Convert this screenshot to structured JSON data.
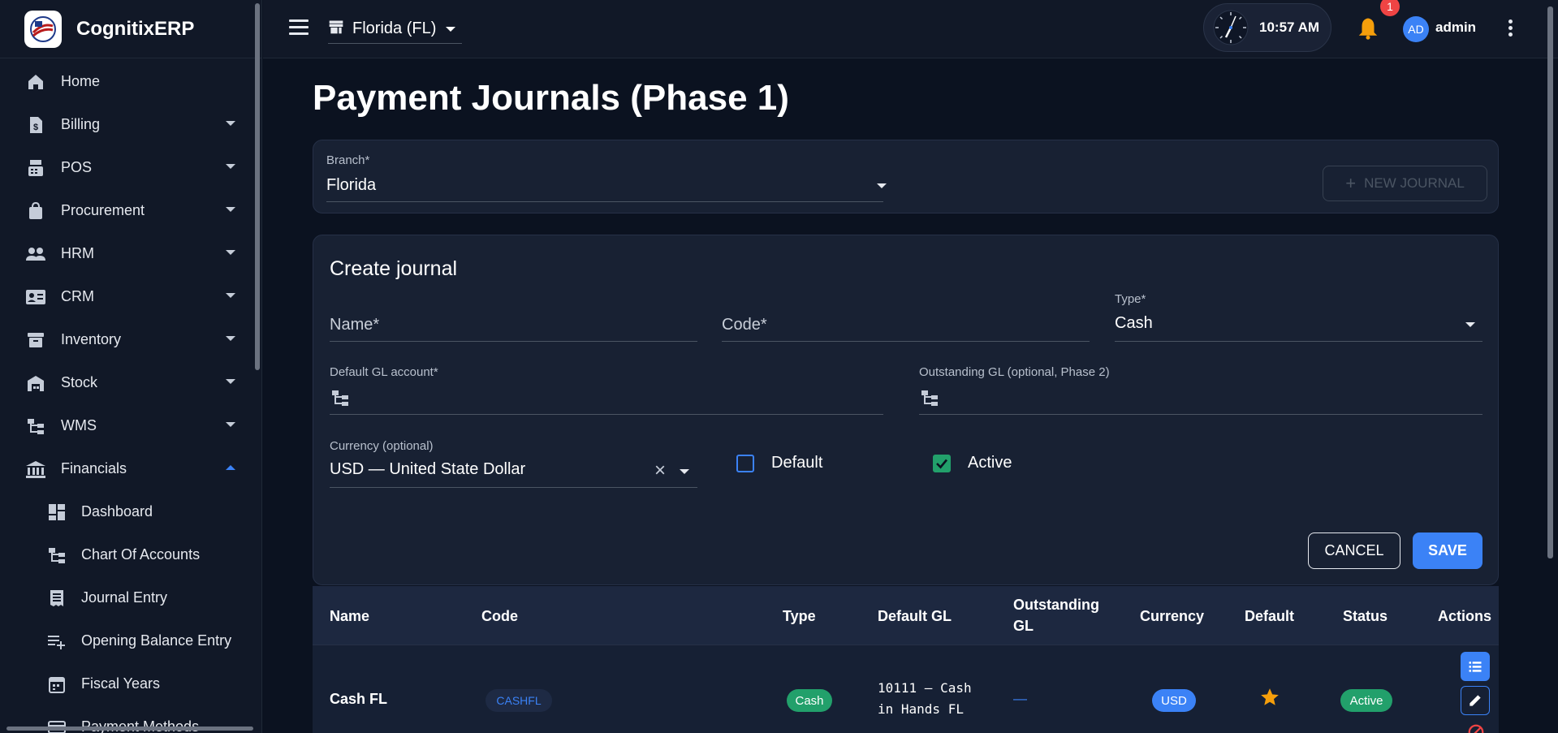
{
  "brand": {
    "name": "CognitixERP"
  },
  "sidebar": {
    "items": [
      {
        "label": "Home",
        "icon": "home-icon"
      },
      {
        "label": "Billing",
        "icon": "billing-icon"
      },
      {
        "label": "POS",
        "icon": "pos-icon"
      },
      {
        "label": "Procurement",
        "icon": "shopping-bag-icon"
      },
      {
        "label": "HRM",
        "icon": "people-icon"
      },
      {
        "label": "CRM",
        "icon": "contact-card-icon"
      },
      {
        "label": "Inventory",
        "icon": "archive-icon"
      },
      {
        "label": "Stock",
        "icon": "warehouse-icon"
      },
      {
        "label": "WMS",
        "icon": "hierarchy-icon"
      },
      {
        "label": "Financials",
        "icon": "bank-icon"
      }
    ],
    "sub_items": [
      {
        "label": "Dashboard",
        "icon": "dashboard-icon"
      },
      {
        "label": "Chart Of Accounts",
        "icon": "hierarchy-icon"
      },
      {
        "label": "Journal Entry",
        "icon": "receipt-icon"
      },
      {
        "label": "Opening Balance Entry",
        "icon": "playlist-add-icon"
      },
      {
        "label": "Fiscal Years",
        "icon": "calendar-icon"
      },
      {
        "label": "Payment Methods",
        "icon": "card-icon"
      }
    ]
  },
  "topbar": {
    "branch": "Florida (FL)",
    "time": "10:57 AM",
    "notifications": "1",
    "avatar": "AD",
    "user": "admin"
  },
  "page": {
    "title": "Payment Journals (Phase 1)"
  },
  "branch_card": {
    "label": "Branch*",
    "value": "Florida",
    "new_button": "NEW JOURNAL"
  },
  "form": {
    "title": "Create journal",
    "name_placeholder": "Name*",
    "code_placeholder": "Code*",
    "type_label": "Type*",
    "type_value": "Cash",
    "default_gl_label": "Default GL account*",
    "outstanding_gl_label": "Outstanding GL (optional, Phase 2)",
    "currency_label": "Currency (optional)",
    "currency_value": "USD — United State Dollar",
    "default_label": "Default",
    "default_checked": false,
    "active_label": "Active",
    "active_checked": true,
    "cancel": "CANCEL",
    "save": "SAVE"
  },
  "table": {
    "headers": [
      "Name",
      "Code",
      "Type",
      "Default GL",
      "Outstanding GL",
      "Currency",
      "Default",
      "Status",
      "Actions"
    ],
    "rows": [
      {
        "name": "Cash FL",
        "code": "CASHFL",
        "type": "Cash",
        "default_gl_line1": "10111 — Cash",
        "default_gl_line2": "in Hands FL",
        "outstanding_gl": "—",
        "currency": "USD",
        "default": "star",
        "status": "Active"
      }
    ]
  },
  "colors": {
    "accent": "#3b82f6",
    "success": "#22a06b",
    "star": "#f59e0b",
    "danger": "#ef4444"
  }
}
